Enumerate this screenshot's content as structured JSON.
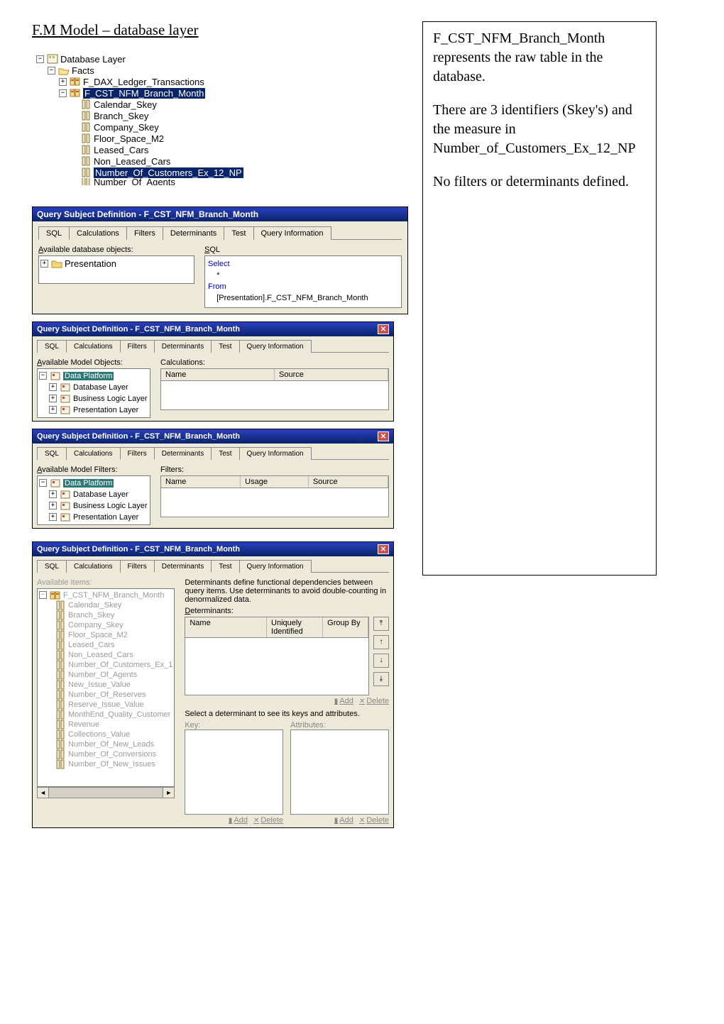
{
  "title": "F.M Model – database layer",
  "right": {
    "p1": "F_CST_NFM_Branch_Month represents the raw table in the database.",
    "p2a": "There are 3 identifiers (Skey's) and the measure in",
    "p2b": "Number_of_Customers_Ex_12_NP",
    "p3": "No filters or determinants defined."
  },
  "tree1": {
    "root": "Database Layer",
    "facts": "Facts",
    "items": [
      "F_DAX_Ledger_Transactions",
      "F_CST_NFM_Branch_Month"
    ],
    "cols": [
      "Calendar_Skey",
      "Branch_Skey",
      "Company_Skey",
      "Floor_Space_M2",
      "Leased_Cars",
      "Non_Leased_Cars",
      "Number_Of_Customers_Ex_12_NP",
      "Number_Of_Agents"
    ]
  },
  "dlg_title": "Query Subject Definition - F_CST_NFM_Branch_Month",
  "tabs": [
    "SQL",
    "Calculations",
    "Filters",
    "Determinants",
    "Test",
    "Query Information"
  ],
  "dlg1": {
    "left_label_a": "A",
    "left_label": "vailable database objects:",
    "tree_item": "Presentation",
    "sql_label_s": "S",
    "sql_label": "QL",
    "sql_kw1": "Select",
    "sql_star": "*",
    "sql_kw2": "From",
    "sql_from": "[Presentation].F_CST_NFM_Branch_Month"
  },
  "dlg2": {
    "left_label_a": "A",
    "left_label": "vailable Model Objects:",
    "tree_root": "Data Platform",
    "tree_items": [
      "Database Layer",
      "Business Logic Layer",
      "Presentation Layer"
    ],
    "right_label": "Calculations:",
    "grid_cols": [
      "Name",
      "Source"
    ]
  },
  "dlg3": {
    "left_label_a": "A",
    "left_label": "vailable Model Filters:",
    "tree_root": "Data Platform",
    "tree_items": [
      "Database Layer",
      "Business Logic Layer",
      "Presentation Layer"
    ],
    "right_label": "Filters:",
    "grid_cols": [
      "Name",
      "Usage",
      "Source"
    ]
  },
  "dlg4": {
    "left_label": "Available Items:",
    "tree_root": "F_CST_NFM_Branch_Month",
    "cols": [
      "Calendar_Skey",
      "Branch_Skey",
      "Company_Skey",
      "Floor_Space_M2",
      "Leased_Cars",
      "Non_Leased_Cars",
      "Number_Of_Customers_Ex_1",
      "Number_Of_Agents",
      "New_Issue_Value",
      "Number_Of_Reserves",
      "Reserve_Issue_Value",
      "MonthEnd_Quality_Customer",
      "Revenue",
      "Collections_Value",
      "Number_Of_New_Leads",
      "Number_Of_Conversions",
      "Number_Of_New_Issues"
    ],
    "hint": "Determinants define functional dependencies between query items. Use determinants to avoid double-counting in denormalized data.",
    "det_label_d": "D",
    "det_label": "eterminants:",
    "det_cols": [
      "Name",
      "Uniquely Identified",
      "Group By"
    ],
    "sel_hint": "Select a determinant to see its keys and attributes.",
    "key_label": "Key:",
    "attr_label": "Attributes:",
    "add": "Add",
    "delete": "Delete"
  }
}
